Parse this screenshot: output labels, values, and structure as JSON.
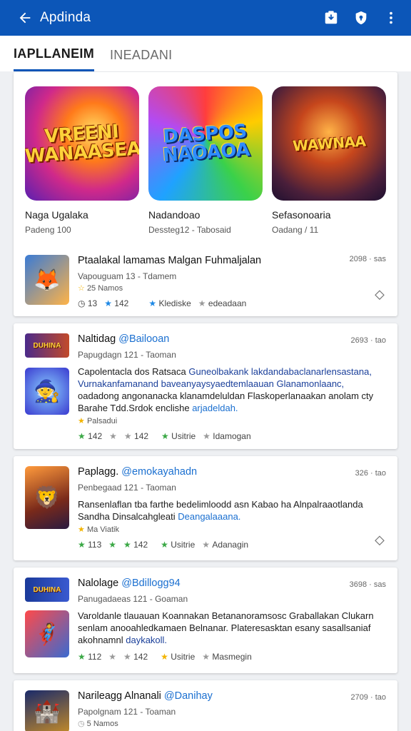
{
  "appbar": {
    "title": "Apdinda"
  },
  "tabs": [
    {
      "label": "IAPLLANEIM"
    },
    {
      "label": "INEADANI"
    }
  ],
  "featured": [
    {
      "name": "Naga Ugalaka",
      "sub": "Padeng 100",
      "logo": "VREENI WANAASEA"
    },
    {
      "name": "Nadandoao",
      "sub": "Dessteg12 - Tabosaid",
      "logo": "DASPOS NAOAOA"
    },
    {
      "name": "Sefasonoaria",
      "sub": "Oadang / 11",
      "logo": "WAWNAA"
    }
  ],
  "list": [
    {
      "title": "Ptaalakal lamamas Malgan Fuhmaljalan",
      "link": "",
      "meta": "Vapouguam 13 - Tdamem",
      "time": "2098 · sas",
      "note": "25 Namos",
      "stats": [
        "13",
        "142",
        "Klediske",
        "edeadaan"
      ]
    },
    {
      "title": "Naltidag",
      "link": "Bailooan",
      "meta": "Papugdagn 121 - Taoman",
      "time": "2693 · tao",
      "desc": [
        "Capolentacla dos Ratsaca",
        "Guneolbakank lakdandabaclanarlensastana,",
        "Vurnakanfamanand baveanyaysyaedtemlaauan Glanamonlaanc,",
        "oadadong angonanacka klanamdeluldan Flaskoperlanaakan anolam cty",
        "Barahe Tdd.Srdok enclishe",
        "arjadeldah."
      ],
      "note": "Palsadui",
      "stats": [
        "142",
        "142",
        "Usitrie",
        "Idamogan"
      ]
    },
    {
      "title": "Paplagg.",
      "link": "emokayahadn",
      "meta": "Penbegaad 121 - Taoman",
      "time": "326 · tao",
      "desc": [
        "Ransenlaflan tba farthe bedelimloodd asn Kabao ha Alnpalraaotlanda",
        "Sandha Dinsalcahgleati",
        "Deangalaaana."
      ],
      "note": "Ma Viatik",
      "stats": [
        "113",
        "142",
        "Usitrie",
        "Adanagin"
      ]
    },
    {
      "title": "Nalolage",
      "link": "Bdillogg94",
      "meta": "Panugadaeas 121 - Goaman",
      "time": "3698 · sas",
      "desc": [
        "Varoldanle tlauauan Koannakan Betananoramsosc Graballakan Clukarn",
        "senlam anooahledkamaen Belnanar. Plateresasktan esany sasallsaniaf",
        "akohnamnl",
        "daykakoll."
      ],
      "stats": [
        "112",
        "142",
        "Usitrie",
        "Masmegin"
      ]
    },
    {
      "title": "Narileagg Alnanali",
      "link": "Danihay",
      "meta": "Papolgnam 121 - Toaman",
      "time": "2709 · tao",
      "note": "5 Namos"
    }
  ],
  "colors": {
    "primary": "#0c56b8",
    "link": "#1a6fd0",
    "star_blue": "#1e88e5",
    "star_green": "#3aa845"
  },
  "icons": [
    "back-arrow-icon",
    "download-icon",
    "shield-icon",
    "more-vert-icon",
    "star-icon",
    "clock-icon",
    "share-icon"
  ]
}
